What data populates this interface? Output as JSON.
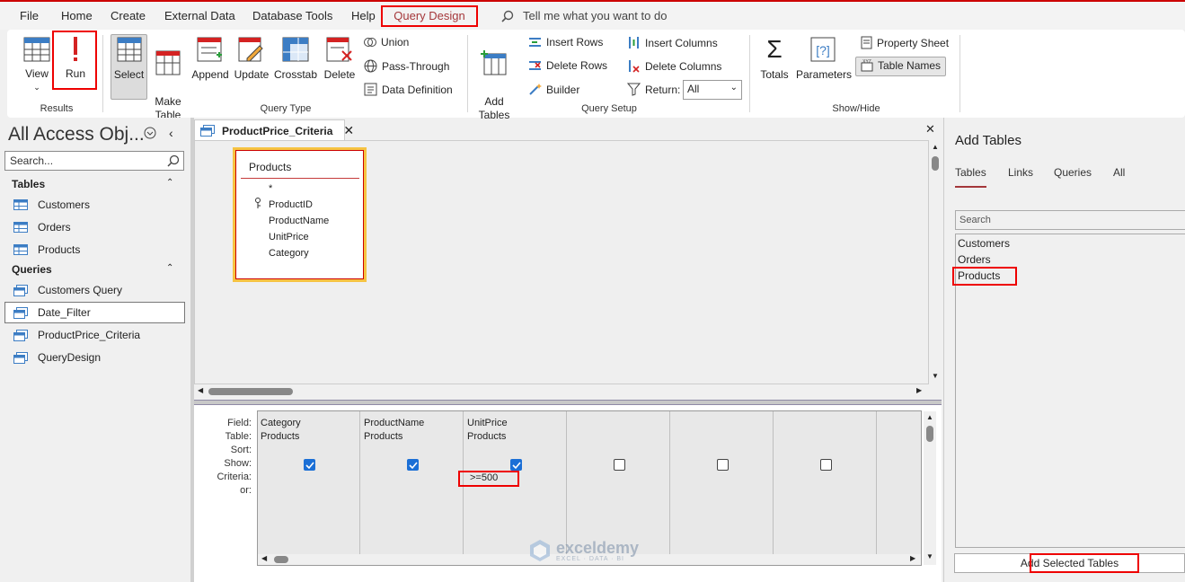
{
  "menu": {
    "tabs": [
      "File",
      "Home",
      "Create",
      "External Data",
      "Database Tools",
      "Help"
    ],
    "active_tab": "Query Design",
    "tell_me": "Tell me what you want to do"
  },
  "ribbon": {
    "results": {
      "view": "View",
      "run": "Run",
      "group": "Results"
    },
    "query_type": {
      "select": "Select",
      "make_table": "Make\nTable",
      "append": "Append",
      "update": "Update",
      "crosstab": "Crosstab",
      "delete": "Delete",
      "union": "Union",
      "pass_through": "Pass-Through",
      "data_definition": "Data Definition",
      "group": "Query Type"
    },
    "query_setup": {
      "add_tables": "Add\nTables",
      "insert_rows": "Insert Rows",
      "delete_rows": "Delete Rows",
      "builder": "Builder",
      "insert_columns": "Insert Columns",
      "delete_columns": "Delete Columns",
      "return_label": "Return:",
      "return_value": "All",
      "group": "Query Setup"
    },
    "show_hide": {
      "totals": "Totals",
      "parameters": "Parameters",
      "property_sheet": "Property Sheet",
      "table_names": "Table Names",
      "group": "Show/Hide"
    }
  },
  "nav": {
    "title": "All Access Obj...",
    "search_placeholder": "Search...",
    "tables_header": "Tables",
    "tables": [
      "Customers",
      "Orders",
      "Products"
    ],
    "queries_header": "Queries",
    "queries": [
      "Customers Query",
      "Date_Filter",
      "ProductPrice_Criteria",
      "QueryDesign"
    ]
  },
  "document": {
    "tab_label": "ProductPrice_Criteria",
    "table_box": {
      "title": "Products",
      "fields": [
        "*",
        "ProductID",
        "ProductName",
        "UnitPrice",
        "Category"
      ]
    }
  },
  "grid": {
    "row_labels": [
      "Field:",
      "Table:",
      "Sort:",
      "Show:",
      "Criteria:",
      "or:"
    ],
    "columns": [
      {
        "field": "Category",
        "table": "Products",
        "show": true,
        "criteria": ""
      },
      {
        "field": "ProductName",
        "table": "Products",
        "show": true,
        "criteria": ""
      },
      {
        "field": "UnitPrice",
        "table": "Products",
        "show": true,
        "criteria": ">=500"
      },
      {
        "field": "",
        "table": "",
        "show": false,
        "criteria": ""
      },
      {
        "field": "",
        "table": "",
        "show": false,
        "criteria": ""
      },
      {
        "field": "",
        "table": "",
        "show": false,
        "criteria": ""
      }
    ]
  },
  "watermark": {
    "name": "exceldemy",
    "tagline": "EXCEL · DATA · BI"
  },
  "add_tables": {
    "title": "Add Tables",
    "tabs": [
      "Tables",
      "Links",
      "Queries",
      "All"
    ],
    "search_placeholder": "Search",
    "items": [
      "Customers",
      "Orders",
      "Products"
    ],
    "button": "Add Selected Tables"
  },
  "colors": {
    "accent": "#a4373a",
    "highlight": "#e00000",
    "checkbox": "#1b6fd6"
  }
}
